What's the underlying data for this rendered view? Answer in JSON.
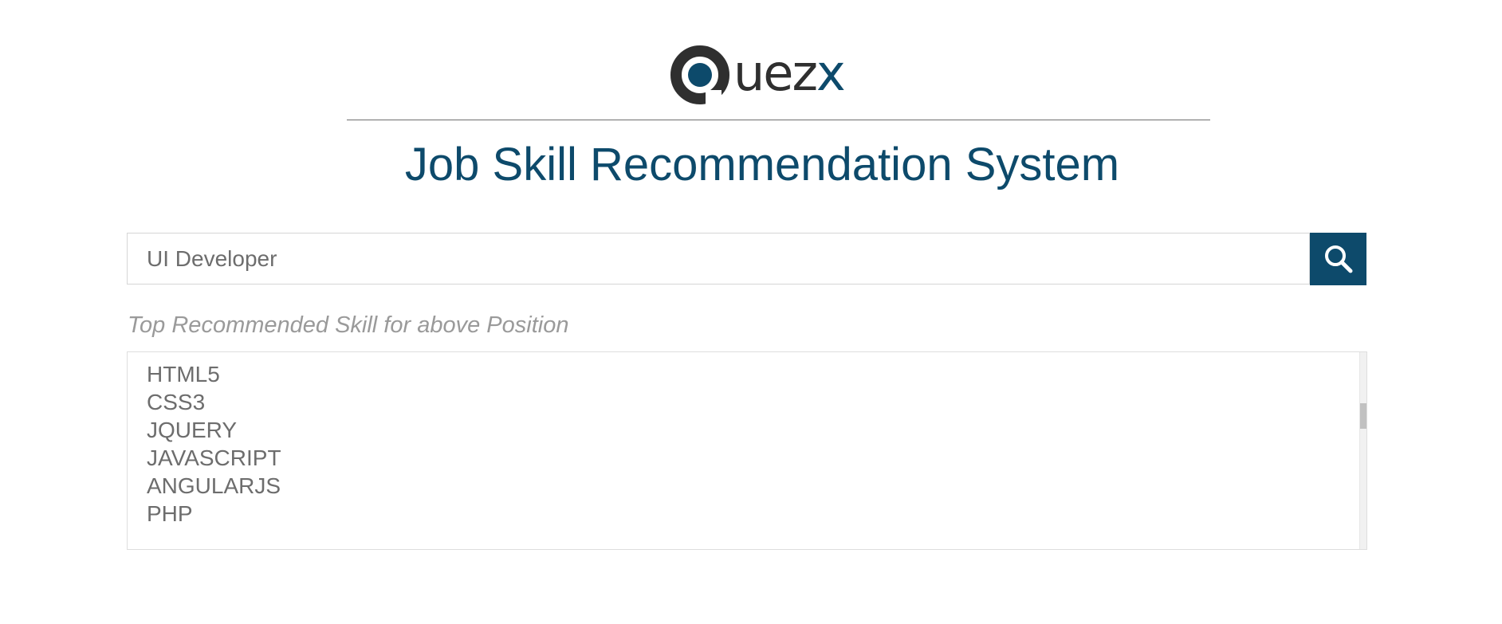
{
  "brand": {
    "logo_dark": "ue",
    "logo_light": "z",
    "logo_accent": "x",
    "colors": {
      "primary": "#0d4a6b",
      "dark": "#2f2f2f",
      "text": "#6d6d6d",
      "muted": "#9a9a9a"
    }
  },
  "header": {
    "title": "Job Skill Recommendation System"
  },
  "search": {
    "value": "UI Developer",
    "placeholder": "",
    "button_icon": "search-icon"
  },
  "results": {
    "label": "Top Recommended Skill for above Position",
    "items": [
      "HTML5",
      "CSS3",
      "JQUERY",
      "JAVASCRIPT",
      "ANGULARJS",
      "PHP"
    ]
  }
}
